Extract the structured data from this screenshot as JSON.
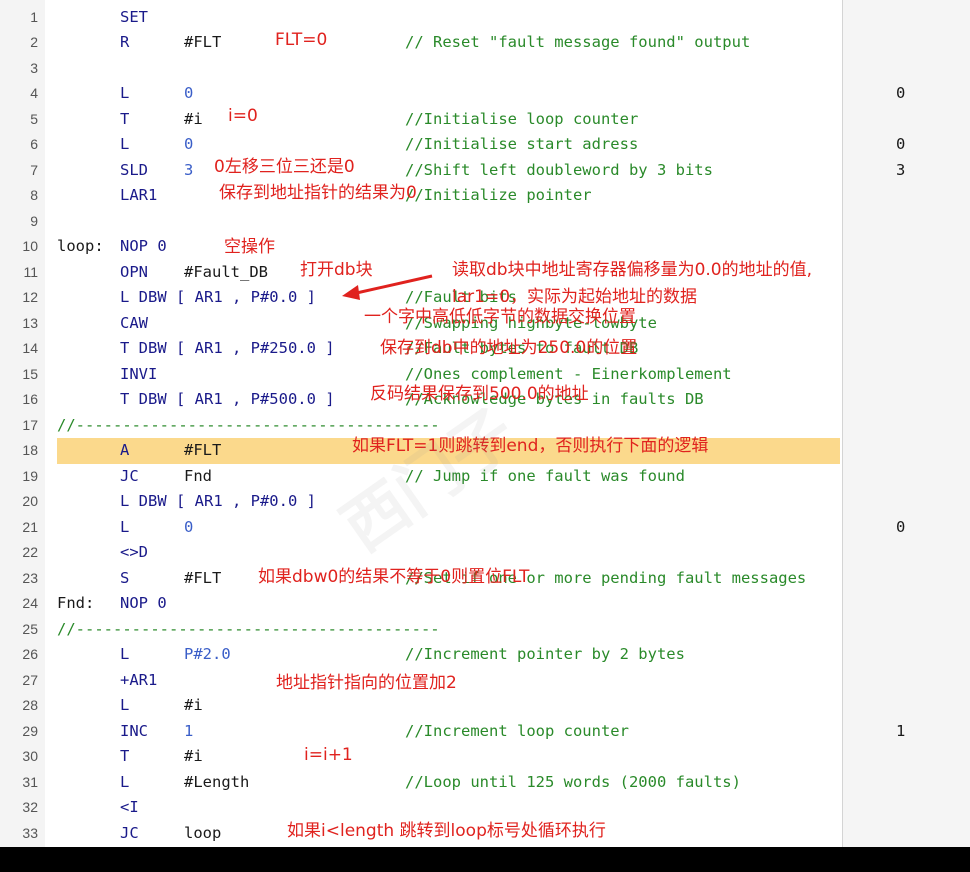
{
  "lines": [
    {
      "n": "1",
      "label": "",
      "op": "SET",
      "arg": "",
      "comment": "",
      "status": ""
    },
    {
      "n": "2",
      "label": "",
      "op": "R",
      "arg": "#FLT",
      "comment": "// Reset \"fault message found\" output",
      "status": ""
    },
    {
      "n": "3",
      "label": "",
      "op": "",
      "arg": "",
      "comment": "",
      "status": ""
    },
    {
      "n": "4",
      "label": "",
      "op": "L",
      "arg": "0",
      "comment": "",
      "status": "0"
    },
    {
      "n": "5",
      "label": "",
      "op": "T",
      "arg": "#i",
      "comment": "//Initialise loop counter",
      "status": ""
    },
    {
      "n": "6",
      "label": "",
      "op": "L",
      "arg": "0",
      "comment": "//Initialise start adress",
      "status": "0"
    },
    {
      "n": "7",
      "label": "",
      "op": "SLD",
      "arg": "3",
      "comment": "//Shift left doubleword by 3 bits",
      "status": "3"
    },
    {
      "n": "8",
      "label": "",
      "op": "LAR1",
      "arg": "",
      "comment": "//Initialize pointer",
      "status": ""
    },
    {
      "n": "9",
      "label": "",
      "op": "",
      "arg": "",
      "comment": "",
      "status": ""
    },
    {
      "n": "10",
      "label": "loop:",
      "op": "NOP 0",
      "arg": "",
      "comment": "",
      "status": ""
    },
    {
      "n": "11",
      "label": "",
      "op": "OPN",
      "arg": "#Fault_DB",
      "comment": "",
      "status": ""
    },
    {
      "n": "12",
      "label": "",
      "op": "L DBW [ AR1 , P#0.0 ]",
      "arg": "",
      "comment": "//Fault bits",
      "status": ""
    },
    {
      "n": "13",
      "label": "",
      "op": "CAW",
      "arg": "",
      "comment": "//Swapping highbyte-lowbyte",
      "status": ""
    },
    {
      "n": "14",
      "label": "",
      "op": "T DBW [ AR1 , P#250.0 ]",
      "arg": "",
      "comment": "//Fault bytes to fault DB",
      "status": ""
    },
    {
      "n": "15",
      "label": "",
      "op": "INVI",
      "arg": "",
      "comment": "//Ones complement - Einerkomplement",
      "status": ""
    },
    {
      "n": "16",
      "label": "",
      "op": "T DBW [ AR1 , P#500.0 ]",
      "arg": "",
      "comment": "//Acknowledge bytes in faults DB",
      "status": ""
    },
    {
      "n": "17",
      "label": "",
      "op": "",
      "arg": "",
      "comment": "",
      "status": "",
      "separator": "//---------------------------------------"
    },
    {
      "n": "18",
      "label": "",
      "op": "A",
      "arg": "#FLT",
      "comment": "",
      "status": ""
    },
    {
      "n": "19",
      "label": "",
      "op": "JC",
      "arg": "Fnd",
      "comment": "// Jump if one fault was found",
      "status": ""
    },
    {
      "n": "20",
      "label": "",
      "op": "L DBW [ AR1 , P#0.0 ]",
      "arg": "",
      "comment": "",
      "status": ""
    },
    {
      "n": "21",
      "label": "",
      "op": "L",
      "arg": "0",
      "comment": "",
      "status": "0"
    },
    {
      "n": "22",
      "label": "",
      "op": "<>D",
      "arg": "",
      "comment": "",
      "status": ""
    },
    {
      "n": "23",
      "label": "",
      "op": "S",
      "arg": "#FLT",
      "comment": "//Set if one or more pending fault messages",
      "status": ""
    },
    {
      "n": "24",
      "label": "Fnd:",
      "op": "NOP 0",
      "arg": "",
      "comment": "",
      "status": ""
    },
    {
      "n": "25",
      "label": "",
      "op": "",
      "arg": "",
      "comment": "",
      "status": "",
      "separator": "//---------------------------------------"
    },
    {
      "n": "26",
      "label": "",
      "op": "L",
      "arg": "P#2.0",
      "comment": "//Increment pointer by 2 bytes",
      "status": ""
    },
    {
      "n": "27",
      "label": "",
      "op": "+AR1",
      "arg": "",
      "comment": "",
      "status": ""
    },
    {
      "n": "28",
      "label": "",
      "op": "L",
      "arg": "#i",
      "comment": "",
      "status": ""
    },
    {
      "n": "29",
      "label": "",
      "op": "INC",
      "arg": "1",
      "comment": "//Increment loop counter",
      "status": "1"
    },
    {
      "n": "30",
      "label": "",
      "op": "T",
      "arg": "#i",
      "comment": "",
      "status": ""
    },
    {
      "n": "31",
      "label": "",
      "op": "L",
      "arg": "#Length",
      "comment": "//Loop until 125 words (2000 faults)",
      "status": ""
    },
    {
      "n": "32",
      "label": "",
      "op": "<I",
      "arg": "",
      "comment": "",
      "status": ""
    },
    {
      "n": "33",
      "label": "",
      "op": "JC",
      "arg": "loop",
      "comment": "",
      "status": ""
    }
  ],
  "highlight_line": "18",
  "annotations": [
    "FLT=0",
    "i=0",
    "0左移三位三还是0",
    "保存到地址指针的结果为0",
    "空操作",
    "打开db块",
    "读取db块中地址寄存器偏移量为0.0的地址的值,",
    "lar1=0，实际为起始地址的数据",
    "一个字中高低低字节的数据交换位置",
    "保存到db中的地址为250.0的位置",
    "反码结果保存到500.0的地址",
    "如果FLT=1则跳转到end，否则执行下面的逻辑",
    "如果dbw0的结果不等于0则置位FLT",
    "地址指针指向的位置加2",
    "i=i+1",
    "如果i<length 跳转到loop标号处循环执行"
  ],
  "colors": {
    "annotation": "#e0221e",
    "comment": "#2a8a2a",
    "operand_pointer": "#3a5ec8",
    "highlight": "#fbd98c"
  }
}
